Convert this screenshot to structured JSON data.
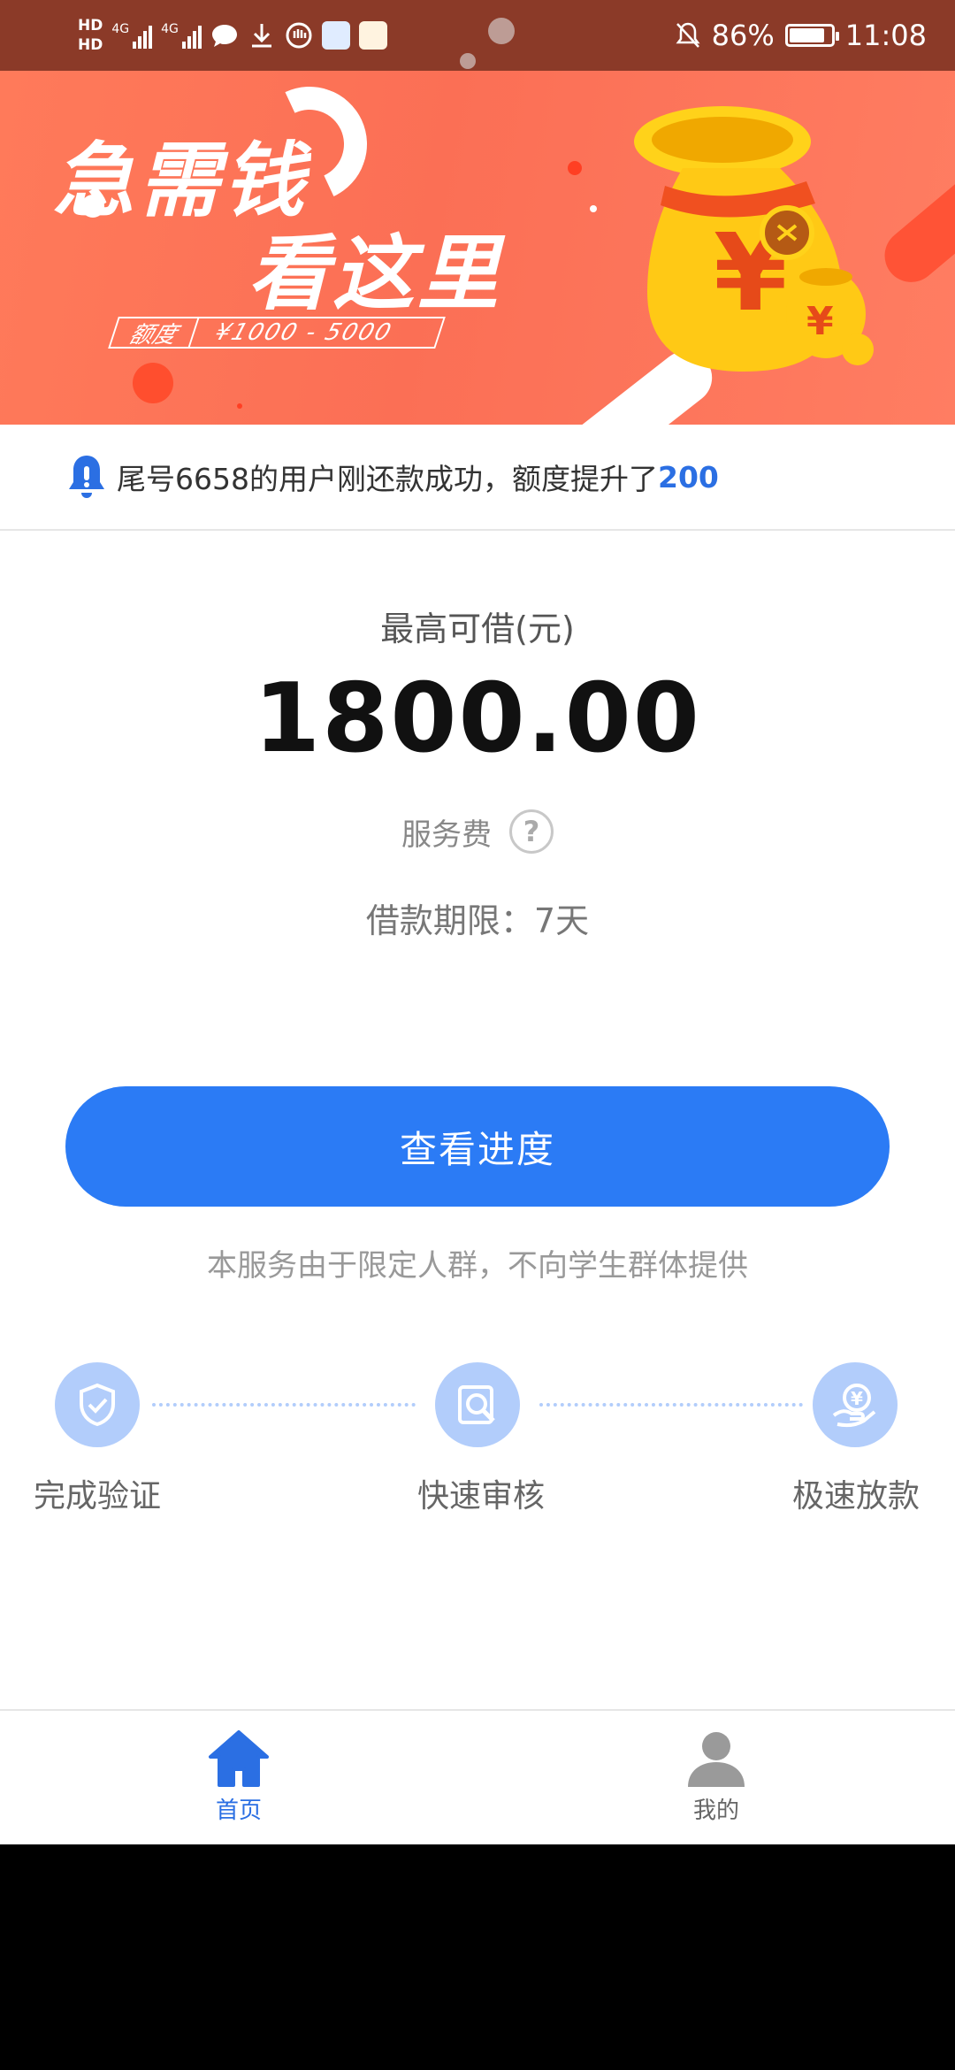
{
  "status_bar": {
    "hd1": "HD",
    "hd2": "HD",
    "sim1_network": "4G",
    "sim2_network": "4G",
    "icons": [
      "message-icon",
      "download-icon",
      "hand-icon",
      "app-icon",
      "app-icon"
    ],
    "battery": "86%",
    "battery_level": 0.86,
    "time": "11:08"
  },
  "banner": {
    "headline_line1": "急需钱",
    "headline_line2": "看这里",
    "quota_label": "额度",
    "quota_range": "¥1000 - 5000",
    "bag_symbol": "¥"
  },
  "notice": {
    "text": "尾号6658的用户刚还款成功，额度提升了",
    "amount": "200"
  },
  "loan": {
    "max_label": "最高可借(元)",
    "amount": "1800.00",
    "fee_label": "服务费",
    "fee_help": "?",
    "term": "借款期限：7天"
  },
  "cta": {
    "label": "查看进度"
  },
  "disclaimer": "本服务由于限定人群，不向学生群体提供",
  "steps": [
    {
      "label": "完成验证"
    },
    {
      "label": "快速审核"
    },
    {
      "label": "极速放款"
    }
  ],
  "step_icon_symbol": "¥",
  "tabbar": {
    "home": "首页",
    "mine": "我的"
  },
  "colors": {
    "primary": "#2b7bf5",
    "banner": "#fb6f55",
    "tab_active": "#2b6fe3",
    "tab_inactive": "#999999"
  }
}
